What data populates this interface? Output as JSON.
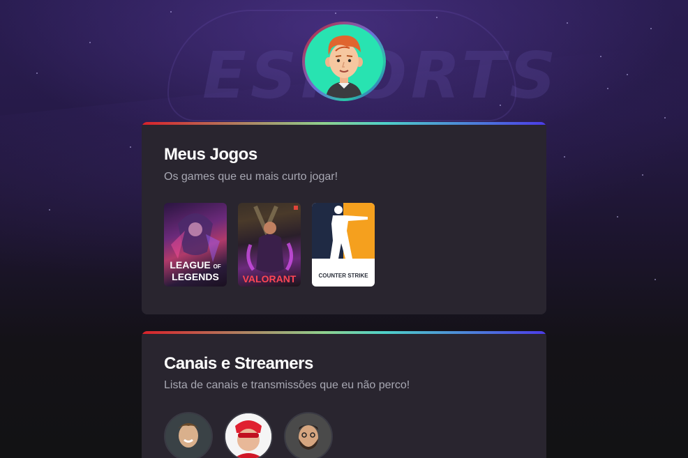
{
  "background": {
    "logo_text": "ESPORTS"
  },
  "profile": {
    "avatar_icon": "cartoon-man-avatar",
    "accent_gradient": [
      "#c4222a",
      "#28c9a6",
      "#4f1fd8"
    ]
  },
  "games_card": {
    "title": "Meus Jogos",
    "subtitle": "Os games que eu mais curto jogar!",
    "games": [
      {
        "name": "League of Legends",
        "label_line1": "LEAGUE",
        "label_of": "OF",
        "label_line2": "LEGENDS"
      },
      {
        "name": "Valorant",
        "label": "VALORANT"
      },
      {
        "name": "Counter Strike",
        "label": "COUNTER STRIKE"
      }
    ]
  },
  "streamers_card": {
    "title": "Canais e Streamers",
    "subtitle": "Lista de canais e transmissões que eu não perco!",
    "streamers": [
      {
        "avatar_icon": "streamer-1-photo"
      },
      {
        "avatar_icon": "streamer-2-photo"
      },
      {
        "avatar_icon": "streamer-3-photo"
      }
    ]
  },
  "colors": {
    "card_bg": "#29252f",
    "subtitle": "#a8a8b3",
    "page_bg": "#121214"
  }
}
